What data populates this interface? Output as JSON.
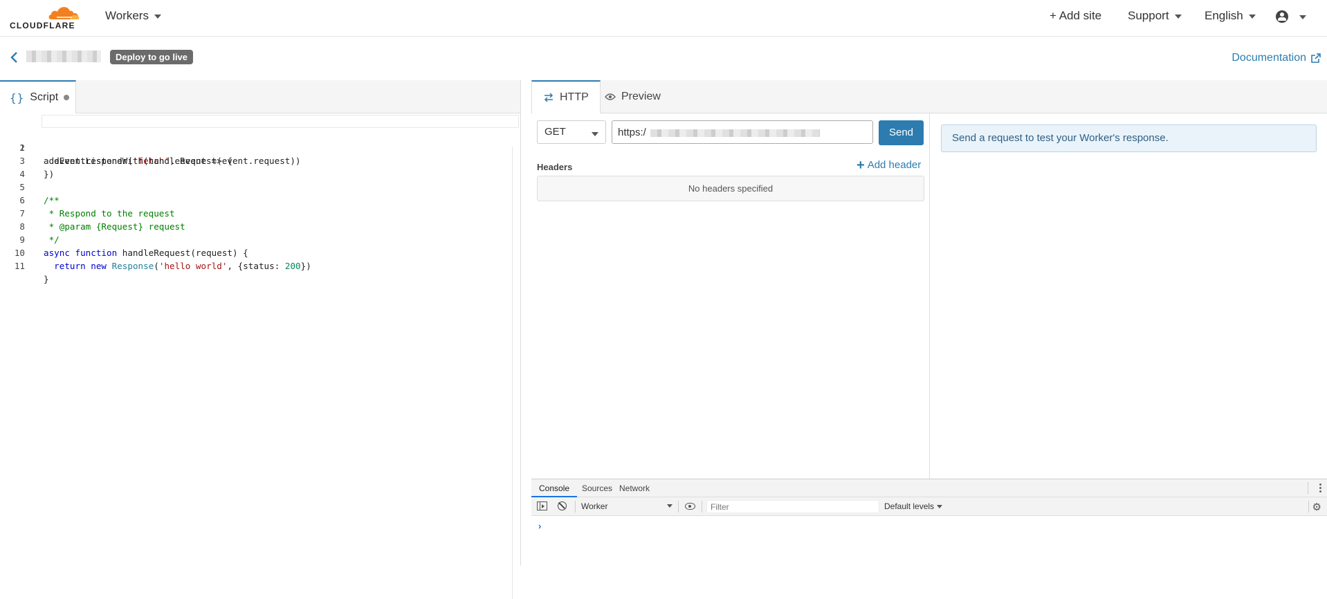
{
  "brand": {
    "logo_text": "CLOUDFLARE",
    "accent": "#f38020"
  },
  "topnav": {
    "product": "Workers",
    "add_site": "+ Add site",
    "support": "Support",
    "language": "English"
  },
  "subheader": {
    "deploy_badge": "Deploy to go live",
    "documentation": "Documentation"
  },
  "editor": {
    "tab_label": "Script",
    "lines": [
      {
        "n": "1"
      },
      {
        "n": "2"
      },
      {
        "n": "3"
      },
      {
        "n": "4"
      },
      {
        "n": "5"
      },
      {
        "n": "6"
      },
      {
        "n": "7"
      },
      {
        "n": "8"
      },
      {
        "n": "9"
      },
      {
        "n": "10"
      },
      {
        "n": "11"
      }
    ],
    "code": {
      "l1a": "addEventListener(",
      "l1b": "'fetch'",
      "l1c": ", event => {",
      "l2": "  event.respondWith(handleRequest(event.request))",
      "l3": "})",
      "l5": "/**",
      "l6": " * Respond to the request",
      "l7": " * @param {Request} request",
      "l8": " */",
      "l9a": "async",
      "l9b": "function",
      "l9c": " handleRequest(request) {",
      "l10a": "  return",
      "l10b": "new",
      "l10c": "Response",
      "l10d": "(",
      "l10e": "'hello world'",
      "l10f": ", {status: ",
      "l10g": "200",
      "l10h": "})",
      "l11": "}"
    }
  },
  "preview_tabs": {
    "http": "HTTP",
    "preview": "Preview"
  },
  "request": {
    "method": "GET",
    "url_prefix": "https:/",
    "send": "Send",
    "headers_label": "Headers",
    "add_header": "Add header",
    "no_headers": "No headers specified"
  },
  "response": {
    "message": "Send a request to test your Worker's response."
  },
  "devtools": {
    "tabs": [
      "Console",
      "Sources",
      "Network"
    ],
    "context": "Worker",
    "filter_placeholder": "Filter",
    "levels": "Default levels",
    "prompt": "›"
  }
}
